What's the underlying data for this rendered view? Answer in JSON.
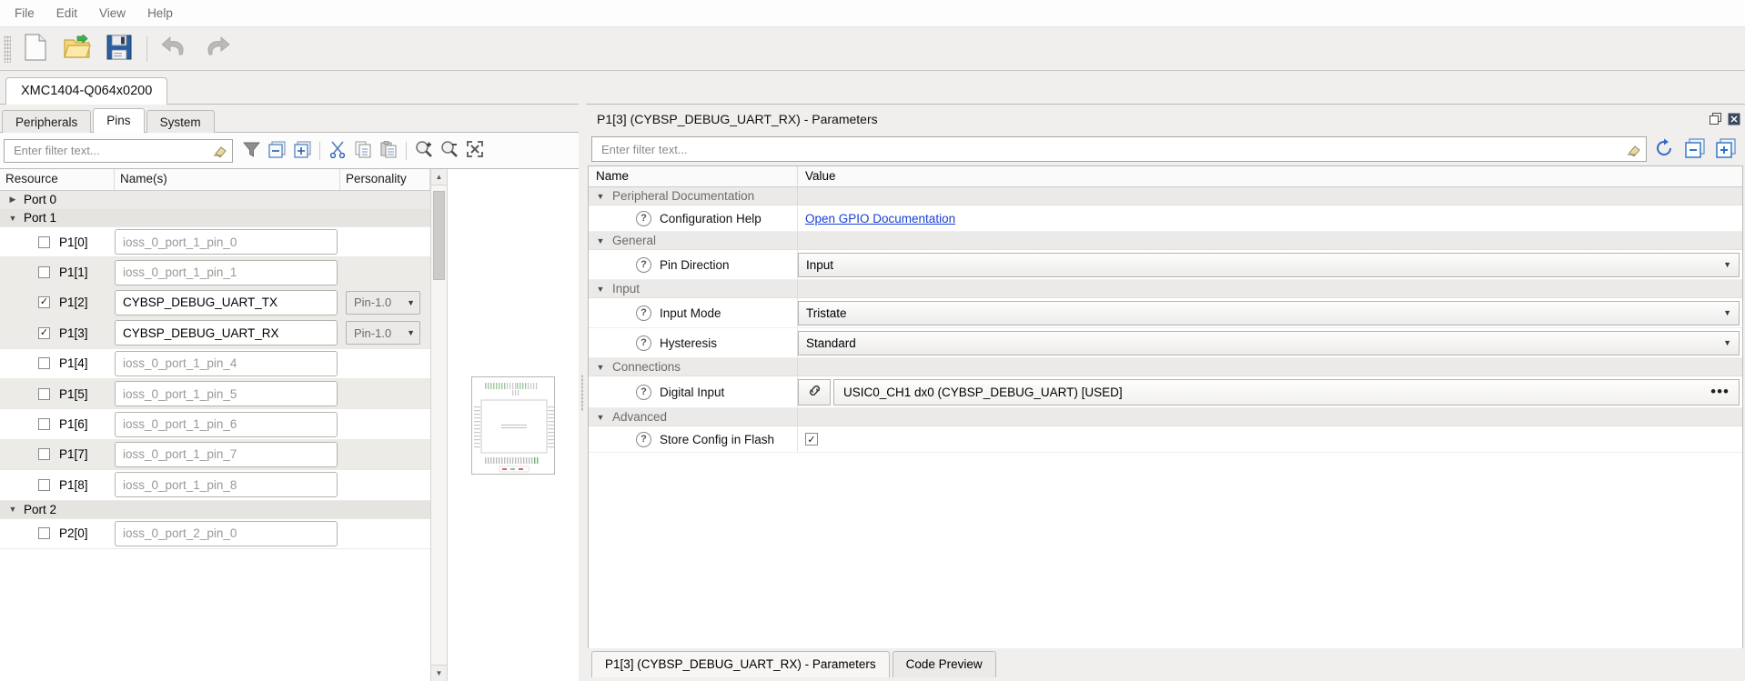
{
  "menu": {
    "items": [
      {
        "label": "File",
        "accel": "F"
      },
      {
        "label": "Edit",
        "accel": "E"
      },
      {
        "label": "View",
        "accel": "V"
      },
      {
        "label": "Help",
        "accel": "H"
      }
    ]
  },
  "toolbar": {
    "items": [
      {
        "name": "new-file-button",
        "icon": "new-document-icon",
        "title": "New"
      },
      {
        "name": "open-file-button",
        "icon": "open-folder-icon",
        "title": "Open"
      },
      {
        "name": "save-file-button",
        "icon": "save-floppy-icon",
        "title": "Save"
      },
      {
        "name": "undo-button",
        "icon": "undo-arrow-icon",
        "title": "Undo"
      },
      {
        "name": "redo-button",
        "icon": "redo-arrow-icon",
        "title": "Redo"
      }
    ]
  },
  "device_tab": {
    "label": "XMC1404-Q064x0200"
  },
  "sub_tabs": [
    {
      "label": "Peripherals",
      "active": false
    },
    {
      "label": "Pins",
      "active": true
    },
    {
      "label": "System",
      "active": false
    }
  ],
  "left_panel": {
    "filter": {
      "placeholder": "Enter filter text...",
      "value": "",
      "clear_icon": "eraser-icon"
    },
    "tools": [
      {
        "name": "filter-funnel-button",
        "icon": "funnel-icon"
      },
      {
        "name": "collapse-all-button",
        "icon": "collapse-all-icon"
      },
      {
        "name": "expand-all-button",
        "icon": "expand-all-icon"
      },
      {
        "name": "cut-button",
        "icon": "scissors-icon"
      },
      {
        "name": "copy-button",
        "icon": "copy-icon"
      },
      {
        "name": "paste-button",
        "icon": "paste-icon"
      },
      {
        "name": "zoom-in-button",
        "icon": "magnifier-plus-icon"
      },
      {
        "name": "zoom-out-button",
        "icon": "magnifier-minus-icon"
      },
      {
        "name": "fit-to-window-button",
        "icon": "fit-window-icon"
      }
    ],
    "columns": [
      "Resource",
      "Name(s)",
      "Personality"
    ],
    "rows": [
      {
        "kind": "group",
        "label": "Port 0",
        "expanded": false,
        "twisty": "▶"
      },
      {
        "kind": "group",
        "label": "Port 1",
        "expanded": true,
        "twisty": "▼"
      },
      {
        "kind": "pin",
        "resource": "P1[0]",
        "checked": false,
        "name": "ioss_0_port_1_pin_0",
        "is_placeholder": true,
        "personality": ""
      },
      {
        "kind": "pin",
        "resource": "P1[1]",
        "checked": false,
        "name": "ioss_0_port_1_pin_1",
        "is_placeholder": true,
        "personality": ""
      },
      {
        "kind": "pin",
        "resource": "P1[2]",
        "checked": true,
        "name": "CYBSP_DEBUG_UART_TX",
        "is_placeholder": false,
        "personality": "Pin-1.0"
      },
      {
        "kind": "pin",
        "resource": "P1[3]",
        "checked": true,
        "name": "CYBSP_DEBUG_UART_RX",
        "is_placeholder": false,
        "personality": "Pin-1.0"
      },
      {
        "kind": "pin",
        "resource": "P1[4]",
        "checked": false,
        "name": "ioss_0_port_1_pin_4",
        "is_placeholder": true,
        "personality": ""
      },
      {
        "kind": "pin",
        "resource": "P1[5]",
        "checked": false,
        "name": "ioss_0_port_1_pin_5",
        "is_placeholder": true,
        "personality": ""
      },
      {
        "kind": "pin",
        "resource": "P1[6]",
        "checked": false,
        "name": "ioss_0_port_1_pin_6",
        "is_placeholder": true,
        "personality": ""
      },
      {
        "kind": "pin",
        "resource": "P1[7]",
        "checked": false,
        "name": "ioss_0_port_1_pin_7",
        "is_placeholder": true,
        "personality": ""
      },
      {
        "kind": "pin",
        "resource": "P1[8]",
        "checked": false,
        "name": "ioss_0_port_1_pin_8",
        "is_placeholder": true,
        "personality": ""
      },
      {
        "kind": "group",
        "label": "Port 2",
        "expanded": true,
        "twisty": "▼"
      },
      {
        "kind": "pin",
        "resource": "P2[0]",
        "checked": false,
        "name": "ioss_0_port_2_pin_0",
        "is_placeholder": true,
        "personality": ""
      }
    ],
    "scrollbar": {
      "up": "▲",
      "down": "▼"
    }
  },
  "right_panel": {
    "title": "P1[3] (CYBSP_DEBUG_UART_RX) - Parameters",
    "window_buttons": [
      {
        "name": "restore-panel-button",
        "icon": "restore-icon"
      },
      {
        "name": "close-panel-button",
        "icon": "close-icon"
      }
    ],
    "filter": {
      "placeholder": "Enter filter text...",
      "value": "",
      "clear_icon": "eraser-icon"
    },
    "tools": [
      {
        "name": "reset-to-default-button",
        "icon": "refresh-circular-arrow-icon",
        "color": "#2e6ec4"
      },
      {
        "name": "collapse-all-button",
        "icon": "collapse-all-icon",
        "color": "#2e6ec4"
      },
      {
        "name": "expand-all-button",
        "icon": "expand-all-icon",
        "color": "#2e6ec4"
      }
    ],
    "columns": [
      "Name",
      "Value"
    ],
    "parameters": [
      {
        "kind": "group",
        "label": "Peripheral Documentation",
        "twisty": "▼"
      },
      {
        "kind": "link",
        "label": "Configuration Help",
        "value": "Open GPIO Documentation"
      },
      {
        "kind": "group",
        "label": "General",
        "twisty": "▼"
      },
      {
        "kind": "combo",
        "label": "Pin Direction",
        "value": "Input"
      },
      {
        "kind": "group",
        "label": "Input",
        "twisty": "▼"
      },
      {
        "kind": "combo",
        "label": "Input Mode",
        "value": "Tristate"
      },
      {
        "kind": "combo",
        "label": "Hysteresis",
        "value": "Standard"
      },
      {
        "kind": "group",
        "label": "Connections",
        "twisty": "▼"
      },
      {
        "kind": "connection",
        "label": "Digital Input",
        "value": "USIC0_CH1 dx0 (CYBSP_DEBUG_UART) [USED]",
        "link_icon": "chain-link-icon",
        "more": "•••"
      },
      {
        "kind": "group",
        "label": "Advanced",
        "twisty": "▼"
      },
      {
        "kind": "checkbox",
        "label": "Store Config in Flash",
        "checked": true
      }
    ]
  },
  "bottom_tabs": [
    {
      "label": "P1[3] (CYBSP_DEBUG_UART_RX) - Parameters",
      "active": true
    },
    {
      "label": "Code Preview",
      "active": false
    }
  ],
  "colors": {
    "link": "#1a3fd4",
    "accent_blue": "#2e6ec4",
    "panel_bg": "#f0efed",
    "row_alt": "#edebe8"
  }
}
